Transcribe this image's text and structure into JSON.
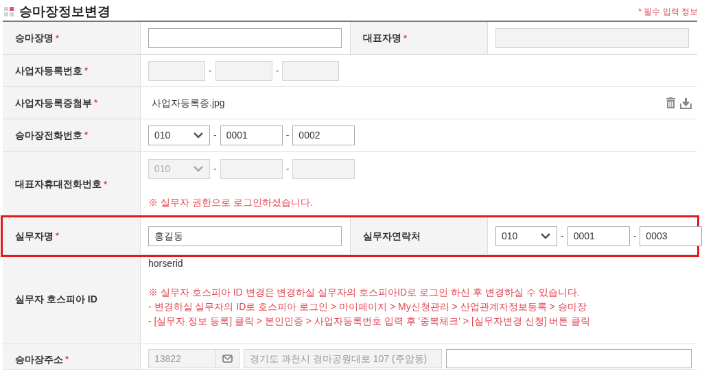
{
  "title": "승마장정보변경",
  "required_note": "* 필수 입력 정보",
  "rows": [
    {
      "kind": "pair",
      "highlighted": false,
      "cells": [
        {
          "label": "승마장명",
          "required_mark": "*",
          "field": {
            "kind": "text",
            "disabled": false
          }
        },
        {
          "label": "대표자명",
          "required_mark": "*",
          "field": {
            "kind": "text",
            "disabled": true
          }
        }
      ]
    },
    {
      "kind": "single",
      "highlighted": false,
      "cells": [
        {
          "label": "사업자등록번호",
          "required_mark": "*",
          "field": {
            "kind": "bizno",
            "separators": [
              "-",
              "-"
            ],
            "parts": [
              {
                "disabled": true
              },
              {
                "disabled": true
              },
              {
                "disabled": true
              }
            ]
          }
        }
      ]
    },
    {
      "kind": "single",
      "highlighted": false,
      "cells": [
        {
          "label": "사업자등록증첨부",
          "required_mark": "*",
          "field": {
            "kind": "file",
            "filename": "사업자등록증.jpg"
          }
        }
      ]
    },
    {
      "kind": "single",
      "highlighted": false,
      "cells": [
        {
          "label": "승마장전화번호",
          "required_mark": "*",
          "field": {
            "kind": "phone",
            "disabled": false,
            "prefix": "010",
            "separators": [
              "-",
              "-"
            ],
            "parts": [
              {
                "value": "0001",
                "disabled": false
              },
              {
                "value": "0002",
                "disabled": false
              }
            ]
          }
        }
      ]
    },
    {
      "kind": "single",
      "highlighted": false,
      "cells": [
        {
          "label": "대표자휴대전화번호",
          "required_mark": "*",
          "field": {
            "kind": "phone",
            "disabled": true,
            "prefix": "010",
            "separators": [
              "-",
              "-"
            ],
            "parts": [
              {
                "disabled": true
              },
              {
                "disabled": true
              }
            ],
            "note": "※ 실무자 권한으로 로그인하셨습니다."
          }
        }
      ]
    },
    {
      "kind": "pair",
      "highlighted": true,
      "cells": [
        {
          "label": "실무자명",
          "required_mark": "*",
          "field": {
            "kind": "text",
            "disabled": false,
            "value": "홍길동"
          }
        },
        {
          "label": "실무자연락처",
          "field": {
            "kind": "phone",
            "disabled": false,
            "prefix": "010",
            "separators": [
              "-",
              "-"
            ],
            "parts": [
              {
                "value": "0001",
                "disabled": false
              },
              {
                "value": "0003",
                "disabled": false
              }
            ]
          }
        }
      ]
    },
    {
      "kind": "single",
      "highlighted": false,
      "cells": [
        {
          "label": "실무자 호스피아 ID",
          "field": {
            "kind": "hospia",
            "value": "horserid",
            "notes": [
              "※ 실무자 호스피아 ID 변경은 변경하실 실무자의 호스피아ID로 로그인 하신 후 변경하실 수 있습니다.",
              "- 변경하실 실무자의 ID로 호스피아 로그인 > 마이페이지 > My신청관리 > 산업관계자정보등록 > 승마장",
              "- [실무자 정보 등록] 클릭 > 본인인증 > 사업자등록번호 입력 후 '중복체크' > [실무자변경 신청] 버튼 클릭"
            ]
          }
        }
      ]
    },
    {
      "kind": "single",
      "highlighted": false,
      "cells": [
        {
          "label": "승마장주소",
          "required_mark": "*",
          "field": {
            "kind": "address",
            "zip": "13822",
            "address": "경기도 과천시 경마공원대로 107 (주암동)"
          }
        }
      ]
    }
  ]
}
